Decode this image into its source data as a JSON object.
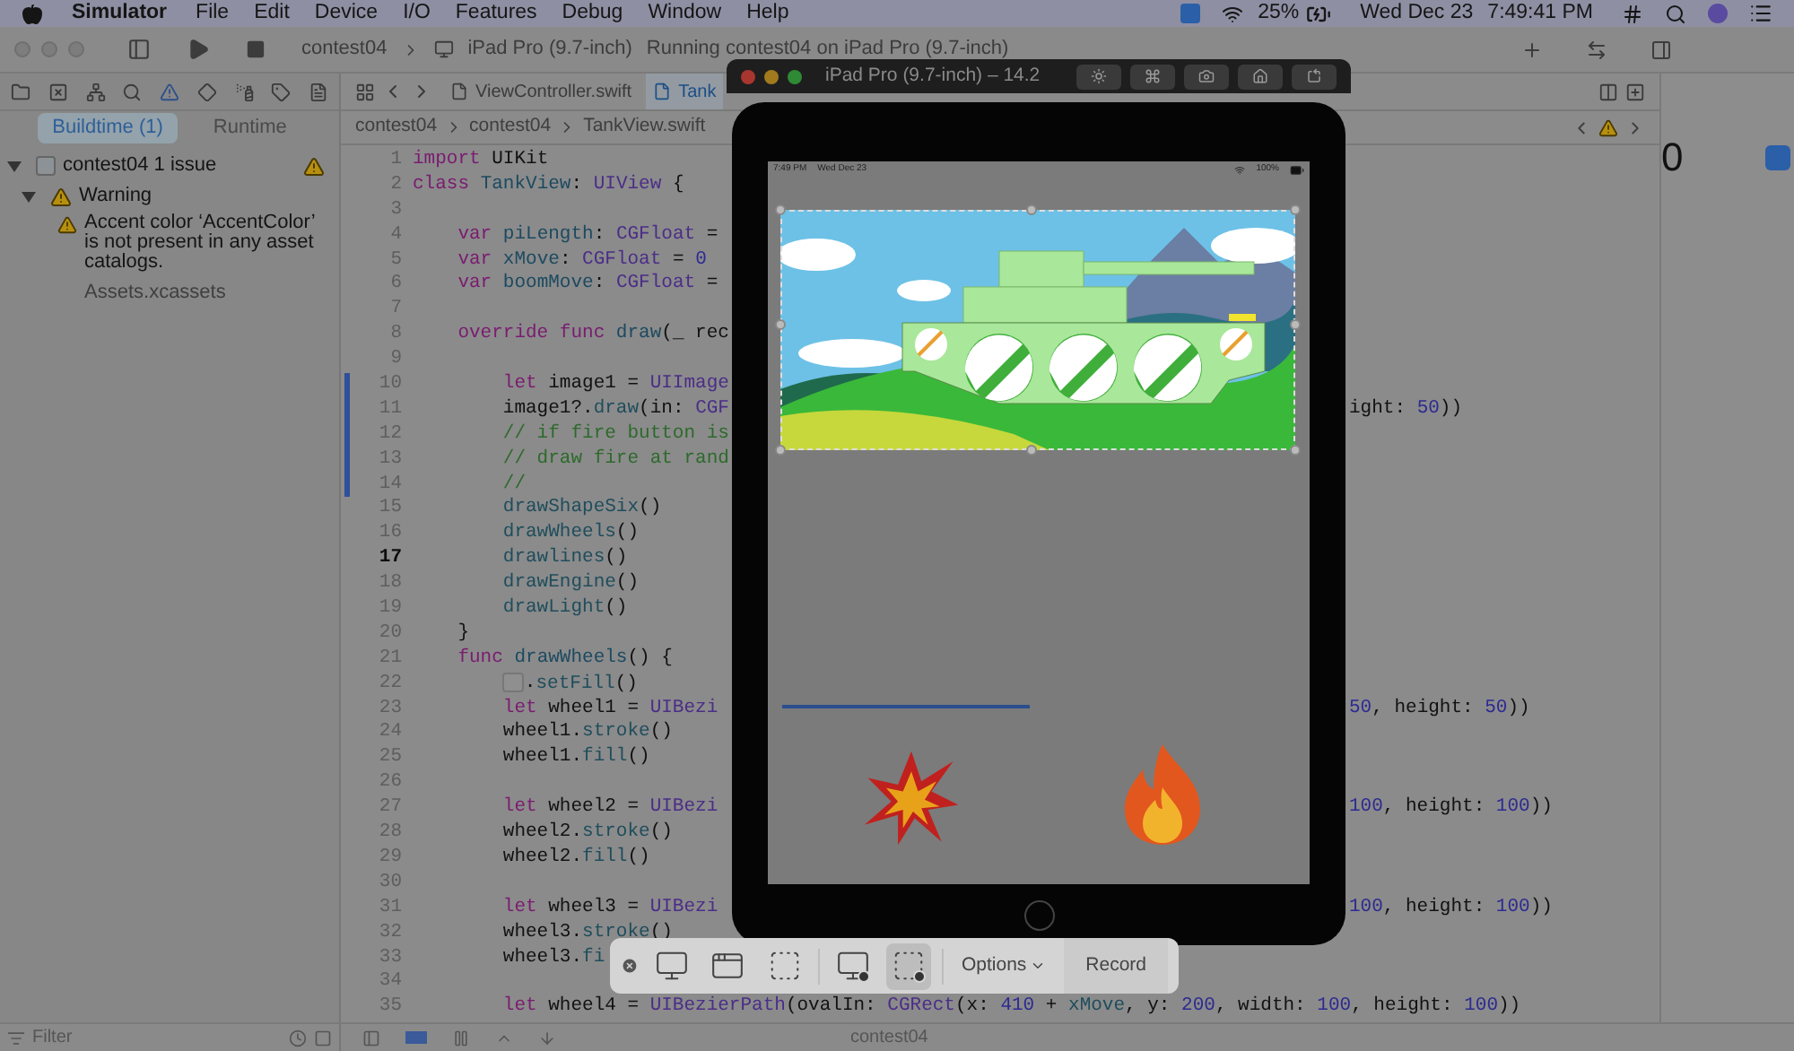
{
  "menu_bar": {
    "app": "Simulator",
    "menus": [
      "File",
      "Edit",
      "Device",
      "I/O",
      "Features",
      "Debug",
      "Window",
      "Help"
    ],
    "battery": "25%",
    "date": "Wed Dec 23",
    "time": "7:49:41 PM"
  },
  "toolbar": {
    "scheme": "contest04",
    "device": "iPad Pro (9.7-inch)",
    "status": "Running contest04 on iPad Pro (9.7-inch)"
  },
  "navigator": {
    "tabs": [
      {
        "label": "Buildtime (1)",
        "selected": true
      },
      {
        "label": "Runtime",
        "selected": false
      }
    ],
    "tree": [
      {
        "label": "contest04",
        "detail": "1 issue",
        "expanded": true,
        "children": [
          {
            "label": "Warning",
            "expanded": true,
            "children": [
              {
                "message": "Accent color ‘AccentColor’ is not present in any asset catalogs.",
                "file": "Assets.xcassets"
              }
            ]
          }
        ]
      }
    ],
    "filter": {
      "placeholder": "Filter"
    }
  },
  "editor": {
    "tabs": [
      {
        "label": "ViewController.swift",
        "selected": false
      },
      {
        "label": "Tank",
        "selected": true
      }
    ],
    "breadcrumbs": [
      "contest04",
      "contest04",
      "TankView.swift"
    ],
    "lines": [
      {
        "n": "1",
        "current": false,
        "changed": false,
        "code": [
          {
            "kind": "keyword",
            "text": "import"
          },
          {
            "kind": "plain",
            "text": " UIKit"
          }
        ]
      },
      {
        "n": "2",
        "current": false,
        "changed": false,
        "code": [
          {
            "kind": "keyword",
            "text": "class "
          },
          {
            "kind": "decl",
            "text": "TankView"
          },
          {
            "kind": "plain",
            "text": ": "
          },
          {
            "kind": "type",
            "text": "UIView"
          },
          {
            "kind": "plain",
            "text": " {"
          }
        ]
      },
      {
        "n": "3",
        "current": false,
        "changed": false
      },
      {
        "n": "4",
        "current": false,
        "changed": false,
        "code": [
          {
            "kind": "keyword",
            "text": "    var "
          },
          {
            "kind": "decl",
            "text": "piLength"
          },
          {
            "kind": "plain",
            "text": ": "
          },
          {
            "kind": "type",
            "text": "CGFloat"
          },
          {
            "kind": "plain",
            "text": " ="
          }
        ]
      },
      {
        "n": "5",
        "current": false,
        "changed": false,
        "code": [
          {
            "kind": "keyword",
            "text": "    var "
          },
          {
            "kind": "decl",
            "text": "xMove"
          },
          {
            "kind": "plain",
            "text": ": "
          },
          {
            "kind": "type",
            "text": "CGFloat"
          },
          {
            "kind": "plain",
            "text": " = "
          },
          {
            "kind": "number",
            "text": "0"
          }
        ]
      },
      {
        "n": "6",
        "current": false,
        "changed": false,
        "code": [
          {
            "kind": "keyword",
            "text": "    var "
          },
          {
            "kind": "decl",
            "text": "boomMove"
          },
          {
            "kind": "plain",
            "text": ": "
          },
          {
            "kind": "type",
            "text": "CGFloat"
          },
          {
            "kind": "plain",
            "text": " ="
          }
        ]
      },
      {
        "n": "7",
        "current": false,
        "changed": false
      },
      {
        "n": "8",
        "current": false,
        "changed": false,
        "code": [
          {
            "kind": "keyword",
            "text": "    override func "
          },
          {
            "kind": "decl",
            "text": "draw"
          },
          {
            "kind": "plain",
            "text": "(_ rec"
          }
        ]
      },
      {
        "n": "9",
        "current": false,
        "changed": false
      },
      {
        "n": "10",
        "current": false,
        "changed": true,
        "code": [
          {
            "kind": "keyword",
            "text": "        let"
          },
          {
            "kind": "plain",
            "text": " image1 = "
          },
          {
            "kind": "type",
            "text": "UIImage"
          }
        ]
      },
      {
        "n": "11",
        "current": false,
        "changed": true,
        "code": [
          {
            "kind": "plain",
            "text": "        image1?."
          },
          {
            "kind": "function",
            "text": "draw"
          },
          {
            "kind": "plain",
            "text": "(in: "
          },
          {
            "kind": "type",
            "text": "CGF"
          }
        ],
        "tail": [
          {
            "kind": "plain",
            "text": "ight: "
          },
          {
            "kind": "number",
            "text": "50"
          },
          {
            "kind": "plain",
            "text": "))"
          }
        ]
      },
      {
        "n": "12",
        "current": false,
        "changed": true,
        "code": [
          {
            "kind": "comment",
            "text": "        // if fire button is"
          }
        ]
      },
      {
        "n": "13",
        "current": false,
        "changed": true,
        "code": [
          {
            "kind": "comment",
            "text": "        // draw fire at rand"
          }
        ]
      },
      {
        "n": "14",
        "current": false,
        "changed": true,
        "code": [
          {
            "kind": "comment",
            "text": "        //"
          }
        ]
      },
      {
        "n": "15",
        "current": false,
        "changed": false,
        "code": [
          {
            "kind": "function",
            "text": "        drawShapeSix"
          },
          {
            "kind": "plain",
            "text": "()"
          }
        ]
      },
      {
        "n": "16",
        "current": false,
        "changed": false,
        "code": [
          {
            "kind": "function",
            "text": "        drawWheels"
          },
          {
            "kind": "plain",
            "text": "()"
          }
        ]
      },
      {
        "n": "17",
        "current": true,
        "changed": false,
        "code": [
          {
            "kind": "function",
            "text": "        drawlines"
          },
          {
            "kind": "plain",
            "text": "()"
          }
        ]
      },
      {
        "n": "18",
        "current": false,
        "changed": false,
        "code": [
          {
            "kind": "function",
            "text": "        drawEngine"
          },
          {
            "kind": "plain",
            "text": "()"
          }
        ]
      },
      {
        "n": "19",
        "current": false,
        "changed": false,
        "code": [
          {
            "kind": "function",
            "text": "        drawLight"
          },
          {
            "kind": "plain",
            "text": "()"
          }
        ]
      },
      {
        "n": "20",
        "current": false,
        "changed": false,
        "code": [
          {
            "kind": "plain",
            "text": "    }"
          }
        ]
      },
      {
        "n": "21",
        "current": false,
        "changed": false,
        "code": [
          {
            "kind": "keyword",
            "text": "    func "
          },
          {
            "kind": "decl",
            "text": "drawWheels"
          },
          {
            "kind": "plain",
            "text": "() {"
          }
        ]
      },
      {
        "n": "22",
        "current": false,
        "changed": false,
        "code": [
          {
            "kind": "swatch",
            "text": "        ."
          },
          {
            "kind": "function",
            "text": "setFill"
          },
          {
            "kind": "plain",
            "text": "()"
          }
        ]
      },
      {
        "n": "23",
        "current": false,
        "changed": false,
        "code": [
          {
            "kind": "keyword",
            "text": "        let"
          },
          {
            "kind": "plain",
            "text": " wheel1 = "
          },
          {
            "kind": "type",
            "text": "UIBezi"
          }
        ],
        "tail": [
          {
            "kind": "number",
            "text": "50"
          },
          {
            "kind": "plain",
            "text": ", height: "
          },
          {
            "kind": "number",
            "text": "50"
          },
          {
            "kind": "plain",
            "text": "))"
          }
        ]
      },
      {
        "n": "24",
        "current": false,
        "changed": false,
        "code": [
          {
            "kind": "plain",
            "text": "        wheel1."
          },
          {
            "kind": "function",
            "text": "stroke"
          },
          {
            "kind": "plain",
            "text": "()"
          }
        ]
      },
      {
        "n": "25",
        "current": false,
        "changed": false,
        "code": [
          {
            "kind": "plain",
            "text": "        wheel1."
          },
          {
            "kind": "function",
            "text": "fill"
          },
          {
            "kind": "plain",
            "text": "()"
          }
        ]
      },
      {
        "n": "26",
        "current": false,
        "changed": false
      },
      {
        "n": "27",
        "current": false,
        "changed": false,
        "code": [
          {
            "kind": "keyword",
            "text": "        let"
          },
          {
            "kind": "plain",
            "text": " wheel2 = "
          },
          {
            "kind": "type",
            "text": "UIBezi"
          }
        ],
        "tail": [
          {
            "kind": "number",
            "text": "100"
          },
          {
            "kind": "plain",
            "text": ", height: "
          },
          {
            "kind": "number",
            "text": "100"
          },
          {
            "kind": "plain",
            "text": "))"
          }
        ]
      },
      {
        "n": "28",
        "current": false,
        "changed": false,
        "code": [
          {
            "kind": "plain",
            "text": "        wheel2."
          },
          {
            "kind": "function",
            "text": "stroke"
          },
          {
            "kind": "plain",
            "text": "()"
          }
        ]
      },
      {
        "n": "29",
        "current": false,
        "changed": false,
        "code": [
          {
            "kind": "plain",
            "text": "        wheel2."
          },
          {
            "kind": "function",
            "text": "fill"
          },
          {
            "kind": "plain",
            "text": "()"
          }
        ]
      },
      {
        "n": "30",
        "current": false,
        "changed": false
      },
      {
        "n": "31",
        "current": false,
        "changed": false,
        "code": [
          {
            "kind": "keyword",
            "text": "        let"
          },
          {
            "kind": "plain",
            "text": " wheel3 = "
          },
          {
            "kind": "type",
            "text": "UIBezi"
          }
        ],
        "tail": [
          {
            "kind": "number",
            "text": "100"
          },
          {
            "kind": "plain",
            "text": ", height: "
          },
          {
            "kind": "number",
            "text": "100"
          },
          {
            "kind": "plain",
            "text": "))"
          }
        ]
      },
      {
        "n": "32",
        "current": false,
        "changed": false,
        "code": [
          {
            "kind": "plain",
            "text": "        wheel3."
          },
          {
            "kind": "function",
            "text": "stroke"
          },
          {
            "kind": "plain",
            "text": "()"
          }
        ]
      },
      {
        "n": "33",
        "current": false,
        "changed": false,
        "code": [
          {
            "kind": "plain",
            "text": "        wheel3."
          },
          {
            "kind": "function",
            "text": "fi"
          }
        ]
      },
      {
        "n": "34",
        "current": false,
        "changed": false
      },
      {
        "n": "35",
        "current": false,
        "changed": false,
        "code": [
          {
            "kind": "keyword",
            "text": "        let"
          },
          {
            "kind": "plain",
            "text": " wheel4 = "
          },
          {
            "kind": "type",
            "text": "UIBezierPath"
          },
          {
            "kind": "plain",
            "text": "(ovalIn: "
          },
          {
            "kind": "type",
            "text": "CGRect"
          },
          {
            "kind": "plain",
            "text": "(x: "
          },
          {
            "kind": "number",
            "text": "410"
          },
          {
            "kind": "plain",
            "text": " + "
          },
          {
            "kind": "function",
            "text": "xMove"
          },
          {
            "kind": "plain",
            "text": ", y: "
          },
          {
            "kind": "number",
            "text": "200"
          },
          {
            "kind": "plain",
            "text": ", width: "
          },
          {
            "kind": "number",
            "text": "100"
          },
          {
            "kind": "plain",
            "text": ", height: "
          },
          {
            "kind": "number",
            "text": "100"
          },
          {
            "kind": "plain",
            "text": "))"
          }
        ]
      }
    ]
  },
  "inspector": {
    "value": "0"
  },
  "debug_bar": {
    "target": "contest04"
  },
  "simulator": {
    "title": "iPad Pro (9.7-inch) – 14.2",
    "status_time": "7:49 PM",
    "status_date": "Wed Dec 23",
    "battery": "100%"
  },
  "record_toolbar": {
    "tools": [
      {
        "kind": "screen",
        "selected": false
      },
      {
        "kind": "window",
        "selected": false
      },
      {
        "kind": "selection",
        "selected": false
      },
      {
        "kind": "record-screen",
        "selected": false
      },
      {
        "kind": "record-selection",
        "selected": true
      }
    ],
    "options": "Options",
    "record": "Record"
  }
}
